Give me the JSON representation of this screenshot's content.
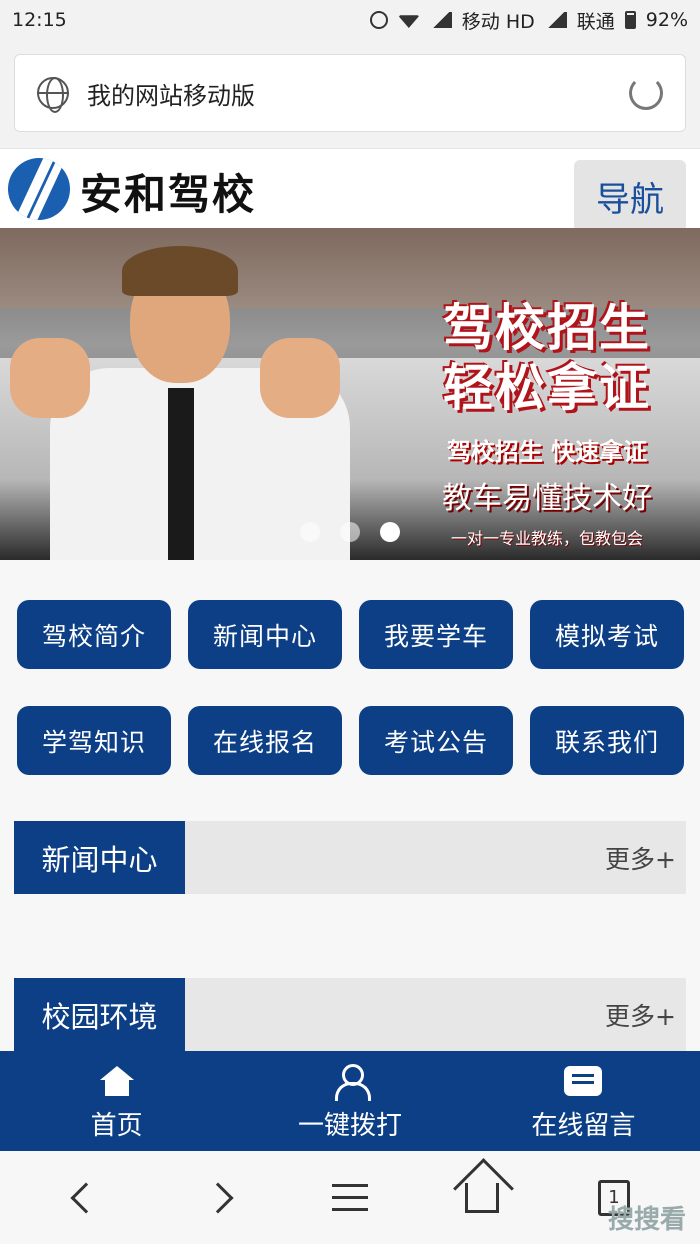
{
  "status_bar": {
    "time": "12:15",
    "carrier1": "移动 HD",
    "carrier2": "联通",
    "battery": "92%"
  },
  "address_bar": {
    "page_title": "我的网站移动版"
  },
  "header": {
    "logo_text": "安和驾校",
    "nav_label": "导航"
  },
  "banner": {
    "headline1": "驾校招生",
    "headline2": "轻松拿证",
    "sub1": "驾校招生 快速拿证",
    "sub2": "教车易懂技术好",
    "sub3": "一对一专业教练，包教包会",
    "slide_count": 3,
    "active_slide": 3
  },
  "menu": [
    "驾校简介",
    "新闻中心",
    "我要学车",
    "模拟考试",
    "学驾知识",
    "在线报名",
    "考试公告",
    "联系我们"
  ],
  "sections": [
    {
      "title": "新闻中心",
      "more": "更多+"
    },
    {
      "title": "校园环境",
      "more": "更多+"
    }
  ],
  "tabbar": [
    {
      "label": "首页",
      "icon": "home-icon"
    },
    {
      "label": "一键拨打",
      "icon": "user-call-icon"
    },
    {
      "label": "在线留言",
      "icon": "message-icon"
    }
  ],
  "system_nav": {
    "tab_count": "1"
  },
  "watermark": "搜搜看",
  "colors": {
    "brand_blue": "#0d3f86",
    "section_bg": "#e7e7e7"
  }
}
